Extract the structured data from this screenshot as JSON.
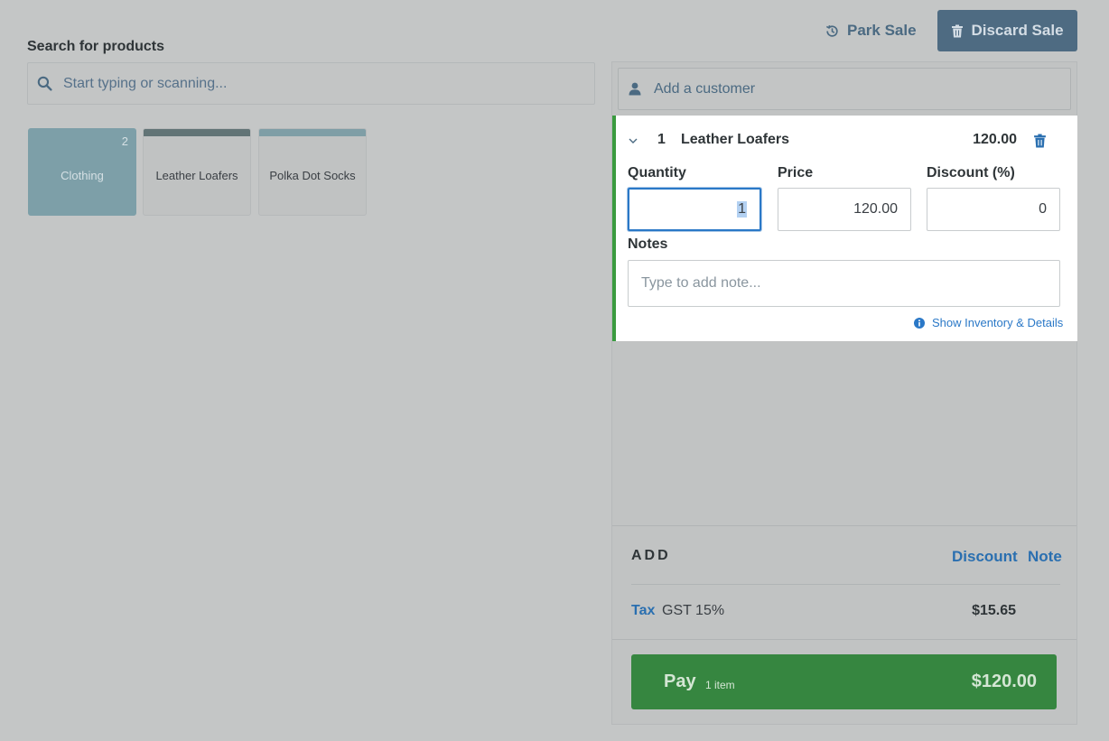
{
  "search": {
    "label": "Search for products",
    "placeholder": "Start typing or scanning..."
  },
  "tiles": [
    {
      "label": "Clothing",
      "count": "2"
    },
    {
      "label": "Leather Loafers"
    },
    {
      "label": "Polka Dot Socks"
    }
  ],
  "header": {
    "park_label": "Park Sale",
    "discard_label": "Discard Sale"
  },
  "customer": {
    "placeholder": "Add a customer"
  },
  "line_item": {
    "quantity": "1",
    "name": "Leather Loafers",
    "price": "120.00",
    "quantity_label": "Quantity",
    "price_label": "Price",
    "discount_label": "Discount (%)",
    "quantity_value": "1",
    "price_value": "120.00",
    "discount_value": "0",
    "notes_label": "Notes",
    "notes_placeholder": "Type to add note...",
    "details_link": "Show Inventory & Details"
  },
  "add_section": {
    "label": "ADD",
    "discount_link": "Discount",
    "note_link": "Note"
  },
  "tax": {
    "link": "Tax",
    "name": "GST 15%",
    "amount": "$15.65"
  },
  "pay": {
    "label": "Pay",
    "items": "1 item",
    "total": "$120.00"
  },
  "colors": {
    "accent_blue": "#2a78c7",
    "pay_green": "#368640",
    "line_item_border": "#3a9b3f",
    "discard_button": "#4e6b82"
  }
}
